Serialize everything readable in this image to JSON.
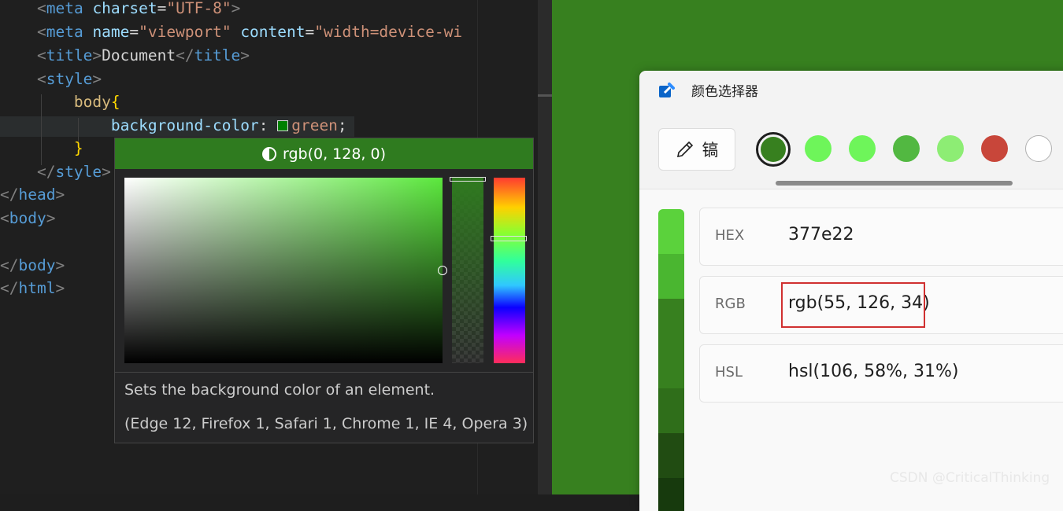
{
  "editor": {
    "line_meta_charset": {
      "indent": "    ",
      "open": "<",
      "tag": "meta",
      "attr": "charset",
      "eq": "=",
      "value": "\"UTF-8\"",
      "close": ">"
    },
    "line_meta_viewport": {
      "indent": "    ",
      "open": "<",
      "tag": "meta",
      "attr1": "name",
      "eq1": "=",
      "value1": "\"viewport\"",
      "attr2": "content",
      "eq2": "=",
      "value2": "\"width=device-wi"
    },
    "line_title": {
      "indent": "    ",
      "open": "<",
      "tag": "title",
      "close": ">",
      "text": "Document",
      "end_open": "</",
      "end_tag": "title",
      "end_close": ">"
    },
    "line_style_open": {
      "indent": "    ",
      "open": "<",
      "tag": "style",
      "close": ">"
    },
    "line_body_selector": {
      "indent": "        ",
      "selector": "body",
      "brace": "{"
    },
    "line_declaration": {
      "indent": "            ",
      "property": "background-color",
      "colon": ": ",
      "value": "green",
      "semicolon": ";"
    },
    "line_body_close": {
      "indent": "        ",
      "brace": "}"
    },
    "line_style_close": {
      "indent": "    ",
      "open": "</",
      "tag": "style",
      "close": ">"
    },
    "line_head_close": {
      "open": "</",
      "tag": "head",
      "close": ">"
    },
    "line_body_open": {
      "open": "<",
      "tag": "body",
      "close": ">"
    },
    "line_body_end": {
      "open": "</",
      "tag": "body",
      "close": ">"
    },
    "line_html_end": {
      "open": "</",
      "tag": "html",
      "close": ">"
    }
  },
  "hover": {
    "color_text": "rgb(0, 128, 0)",
    "header_color": "#2f7b1f",
    "description": "Sets the background color of an element.",
    "compat": "(Edge 12, Firefox 1, Safari 1, Chrome 1, IE 4, Opera 3)"
  },
  "color_picker": {
    "title": "颜色选择器",
    "picker_button_label": "镐",
    "history": [
      "#37801f",
      "#6ef55a",
      "#6ef55a",
      "#52b841",
      "#8ded74",
      "#c8463a",
      "#ffffff"
    ],
    "shades": [
      "#5bd23c",
      "#4ab630",
      "#37801f",
      "#37801f",
      "#2f6e1a",
      "#214c12",
      "#173a0d"
    ],
    "rows": [
      {
        "label": "HEX",
        "value": "377e22"
      },
      {
        "label": "RGB",
        "value": "rgb(55, 126, 34)"
      },
      {
        "label": "HSL",
        "value": "hsl(106, 58%, 31%)"
      }
    ]
  },
  "colors": {
    "desktop": "#37801f",
    "highlight_box": "#d03030",
    "css_green": "#008000"
  },
  "watermark": "CSDN @CriticalThinking"
}
